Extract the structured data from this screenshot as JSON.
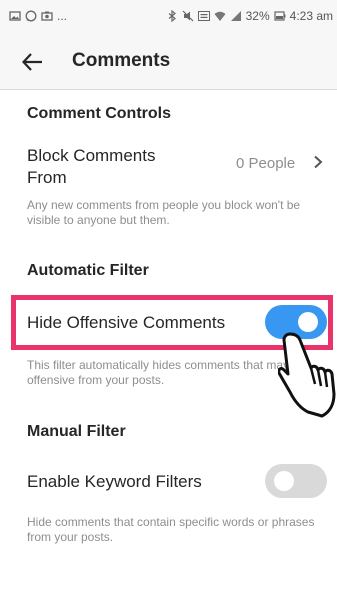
{
  "status_bar": {
    "left_ellipsis": "...",
    "battery": "32%",
    "time": "4:23 am",
    "icons_left": [
      "gallery-icon",
      "whatsapp-icon",
      "camera-icon"
    ],
    "icons_right": [
      "bluetooth-icon",
      "mute-icon",
      "volte-icon",
      "wifi-icon",
      "signal-icon",
      "battery-icon"
    ]
  },
  "header": {
    "title": "Comments",
    "back_icon": "arrow-left-icon"
  },
  "comment_controls": {
    "title": "Comment Controls",
    "block_label": "Block Comments From",
    "block_value": "0 People",
    "block_desc": "Any new comments from people you block won't be visible to anyone but them."
  },
  "automatic_filter": {
    "title": "Automatic Filter",
    "toggle_label": "Hide Offensive Comments",
    "toggle_on": true,
    "desc": "This filter automatically hides comments that may be offensive from your posts."
  },
  "manual_filter": {
    "title": "Manual Filter",
    "toggle_label": "Enable Keyword Filters",
    "toggle_on": false,
    "desc": "Hide comments that contain specific words or phrases from your posts."
  },
  "colors": {
    "accent": "#3897f0",
    "highlight": "#e8336b",
    "toggle_off": "#d9d9d9"
  }
}
